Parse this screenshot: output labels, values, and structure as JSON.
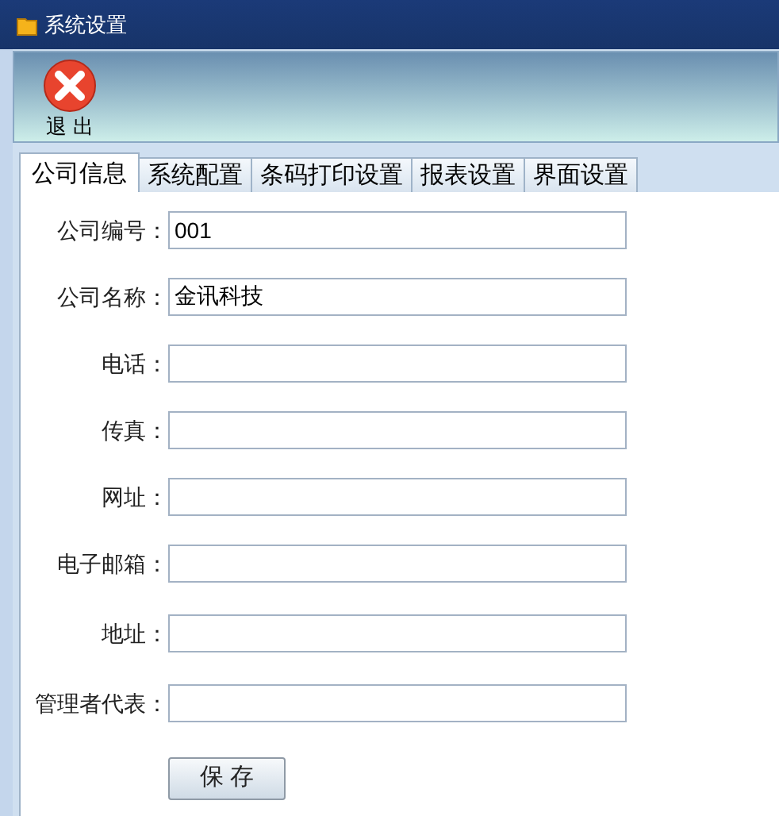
{
  "window": {
    "title": "系统设置"
  },
  "toolbar": {
    "buttons": [
      {
        "label": "退 出"
      }
    ]
  },
  "tabs": [
    {
      "label": "公司信息",
      "selected": true
    },
    {
      "label": "系统配置",
      "selected": false
    },
    {
      "label": "条码打印设置",
      "selected": false
    },
    {
      "label": "报表设置",
      "selected": false
    },
    {
      "label": "界面设置",
      "selected": false
    }
  ],
  "form": {
    "fields": [
      {
        "label": "公司编号：",
        "value": "001"
      },
      {
        "label": "公司名称：",
        "value": "金讯科技"
      },
      {
        "label": "电话："
      },
      {
        "label": "传真："
      },
      {
        "label": "网址："
      },
      {
        "label": "电子邮箱："
      },
      {
        "label": "地址："
      },
      {
        "label": "管理者代表："
      }
    ],
    "save_button": "保 存"
  }
}
